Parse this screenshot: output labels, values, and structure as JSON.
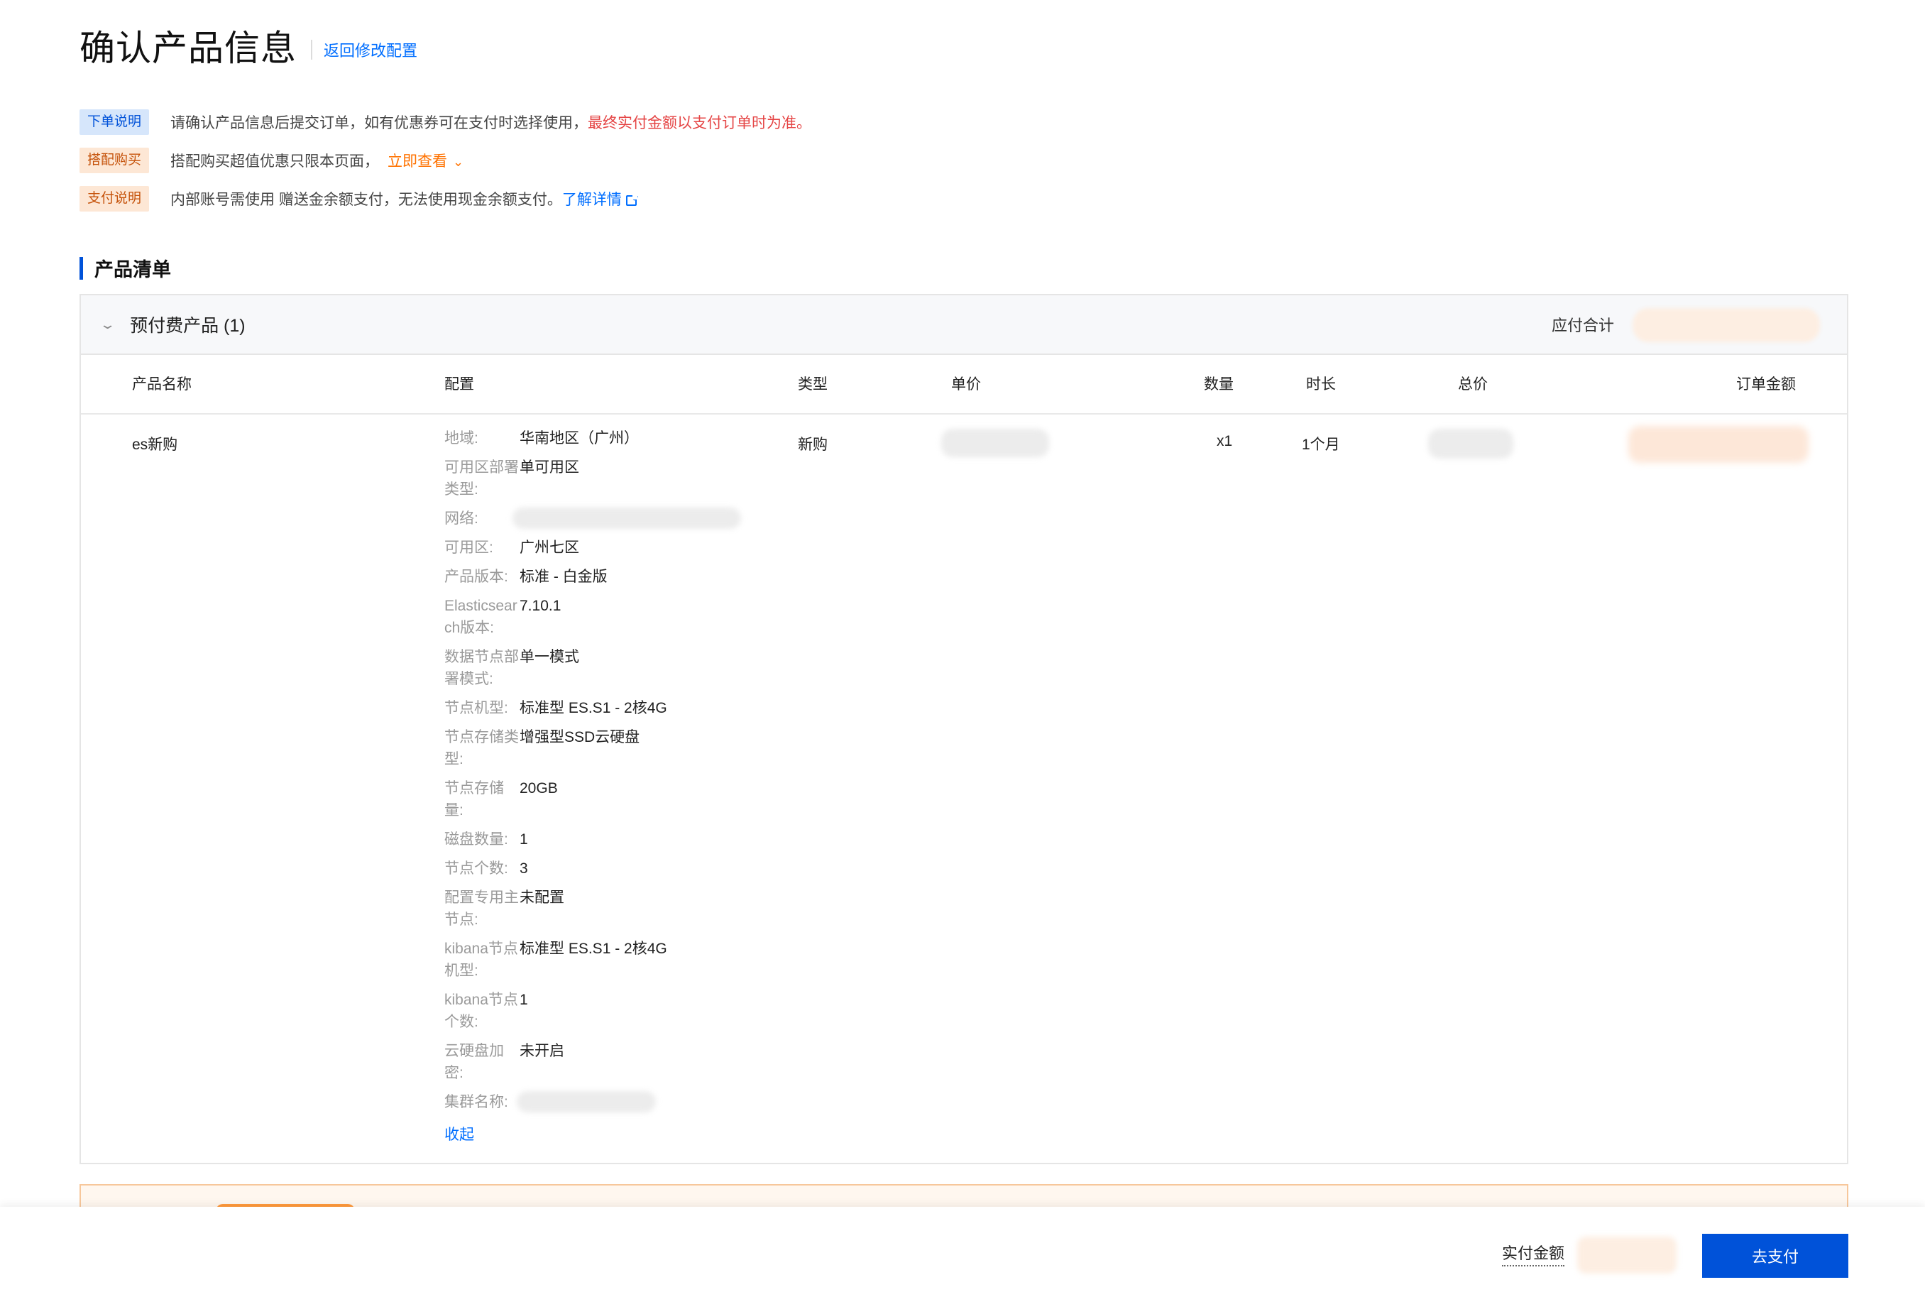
{
  "header": {
    "title": "确认产品信息",
    "back_link": "返回修改配置"
  },
  "notices": [
    {
      "tag": "下单说明",
      "text": "请确认产品信息后提交订单，如有优惠券可在支付时选择使用，",
      "highlight": "最终实付金额以支付订单时为准。"
    },
    {
      "tag": "搭配购买",
      "text": "搭配购买超值优惠只限本页面，",
      "link": "立即查看"
    },
    {
      "tag": "支付说明",
      "text": "内部账号需使用 赠送金余额支付，无法使用现金余额支付。",
      "link": "了解详情"
    }
  ],
  "section": {
    "title": "产品清单"
  },
  "panel": {
    "group_title": "预付费产品 (1)",
    "total_label": "应付合计",
    "columns": [
      "产品名称",
      "配置",
      "类型",
      "单价",
      "数量",
      "时长",
      "总价",
      "订单金额"
    ],
    "row": {
      "name": "es新购",
      "type": "新购",
      "quantity": "x1",
      "duration": "1个月",
      "config": [
        {
          "label": "地域:",
          "value": "华南地区（广州）"
        },
        {
          "label": "可用区部署类型:",
          "value": "单可用区"
        },
        {
          "label": "网络:",
          "value": ""
        },
        {
          "label": "可用区:",
          "value": "广州七区"
        },
        {
          "label": "产品版本:",
          "value": "标准 - 白金版"
        },
        {
          "label": "Elasticsearch版本:",
          "value": "7.10.1"
        },
        {
          "label": "数据节点部署模式:",
          "value": "单一模式"
        },
        {
          "label": "节点机型:",
          "value": "标准型 ES.S1 - 2核4G"
        },
        {
          "label": "节点存储类型:",
          "value": "增强型SSD云硬盘"
        },
        {
          "label": "节点存储量:",
          "value": "20GB"
        },
        {
          "label": "磁盘数量:",
          "value": "1"
        },
        {
          "label": "节点个数:",
          "value": "3"
        },
        {
          "label": "配置专用主节点:",
          "value": "未配置"
        },
        {
          "label": "kibana节点机型:",
          "value": "标准型 ES.S1 - 2核4G"
        },
        {
          "label": "kibana节点个数:",
          "value": "1"
        },
        {
          "label": "云硬盘加密:",
          "value": "未开启"
        },
        {
          "label": "集群名称:",
          "value": ""
        }
      ],
      "collapse_link": "收起"
    }
  },
  "footer": {
    "actual_label": "实付金额",
    "pay_button": "去支付"
  },
  "colors": {
    "primary": "#0052d9",
    "link": "#006eff",
    "warning_red": "#e54545",
    "orange": "#ff7200"
  }
}
